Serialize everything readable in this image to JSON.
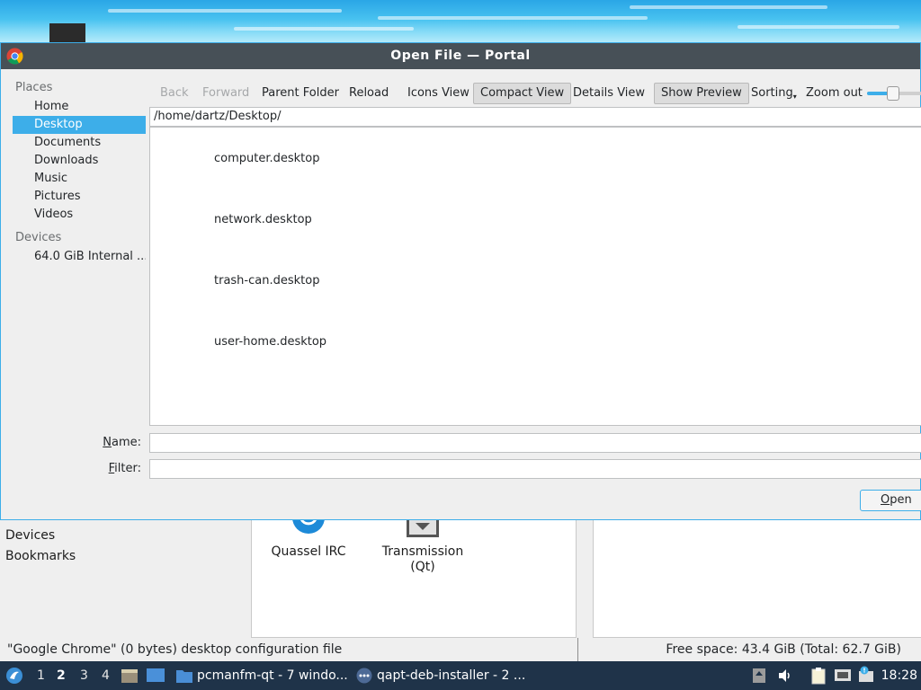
{
  "dialog": {
    "title": "Open File — Portal",
    "places_header": "Places",
    "places": [
      "Home",
      "Desktop",
      "Documents",
      "Downloads",
      "Music",
      "Pictures",
      "Videos"
    ],
    "selected_place": "Desktop",
    "devices_header": "Devices",
    "devices": [
      "64.0 GiB Internal ..."
    ],
    "toolbar": {
      "back": "Back",
      "forward": "Forward",
      "parent_folder": "Parent Folder",
      "reload": "Reload",
      "icons_view": "Icons View",
      "compact_view": "Compact View",
      "details_view": "Details View",
      "show_preview": "Show Preview",
      "sorting": "Sorting",
      "zoom_out": "Zoom out",
      "zoom_level": 0.45
    },
    "path": "/home/dartz/Desktop/",
    "files": [
      "computer.desktop",
      "network.desktop",
      "trash-can.desktop",
      "user-home.desktop"
    ],
    "name_label_prefix": "N",
    "name_label_rest": "ame:",
    "filter_label_prefix": "F",
    "filter_label_rest": "ilter:",
    "name_value": "",
    "filter_value": "",
    "open_prefix": "O",
    "open_rest": "pen"
  },
  "background_window": {
    "sidebar": [
      "Devices",
      "Bookmarks"
    ],
    "apps": [
      "Quassel IRC",
      "Transmission (Qt)"
    ],
    "status_left": "\"Google Chrome\" (0 bytes) desktop configuration file",
    "status_right": "Free space: 43.4 GiB (Total: 62.7 GiB)"
  },
  "taskbar": {
    "workspaces": [
      "1",
      "2",
      "3",
      "4"
    ],
    "active_workspace": "2",
    "tasks": [
      "pcmanfm-qt - 7 windo...",
      "qapt-deb-installer - 2 ..."
    ],
    "clock": "18:28",
    "colors": {
      "panel": "#1f3349",
      "accent": "#3daee9"
    }
  }
}
